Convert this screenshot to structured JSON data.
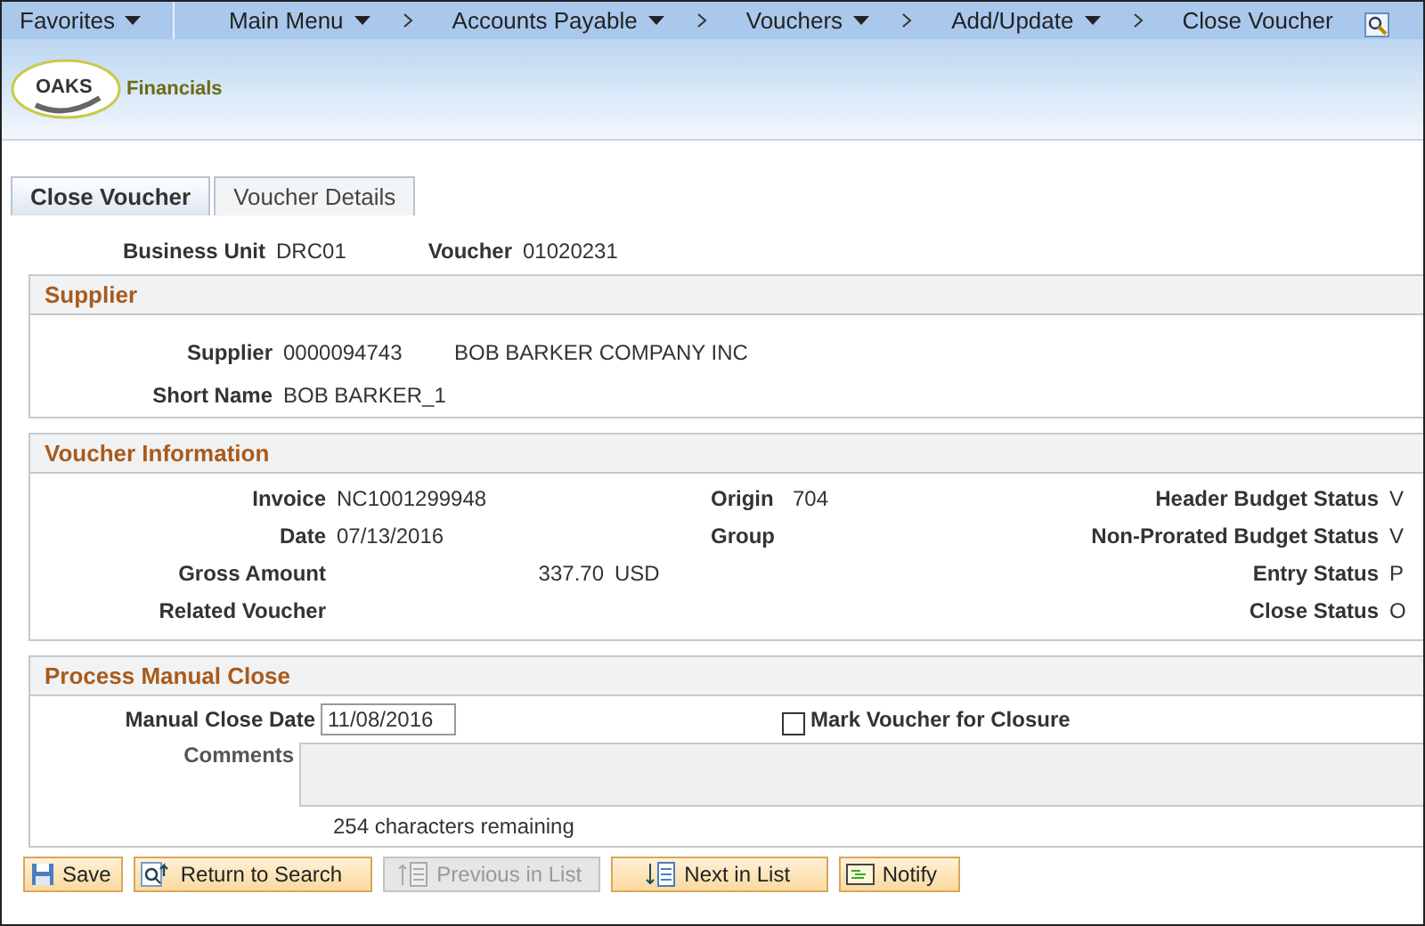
{
  "nav": [
    {
      "label": "Favorites",
      "dropdown": true
    },
    {
      "label": "Main Menu",
      "dropdown": true
    },
    {
      "label": "Accounts Payable",
      "dropdown": true
    },
    {
      "label": "Vouchers",
      "dropdown": true
    },
    {
      "label": "Add/Update",
      "dropdown": true
    },
    {
      "label": "Close Voucher",
      "dropdown": false
    }
  ],
  "logo": {
    "mark": "OAKS",
    "name": "Financials"
  },
  "tabs": [
    {
      "label": "Close Voucher",
      "selected": true
    },
    {
      "label": "Voucher Details",
      "selected": false
    }
  ],
  "header_fields": [
    {
      "label": "Business Unit",
      "value": "DRC01"
    },
    {
      "label": "Voucher",
      "value": "01020231"
    }
  ],
  "supplier": {
    "title": "Supplier",
    "supplier_label": "Supplier",
    "supplier_id": "0000094743",
    "supplier_name": "BOB BARKER COMPANY INC",
    "short_name_label": "Short Name",
    "short_name": "BOB BARKER_1"
  },
  "voucher_information": {
    "title": "Voucher Information",
    "rows": [
      {
        "label_1": "Invoice",
        "value_1": "NC1001299948",
        "label_2": "Origin",
        "value_2": "704",
        "label_3": "Header Budget Status",
        "value_3": "V"
      },
      {
        "label_1": "Date",
        "value_1": "07/13/2016",
        "label_2": "Group",
        "label_3": "Non-Prorated Budget Status",
        "value_3": "V"
      },
      {
        "label_1": "Gross Amount",
        "amount": "337.70",
        "currency": "USD",
        "label_3": "Entry Status",
        "value_3": "P"
      },
      {
        "label_1": "Related Voucher",
        "label_3": "Close Status",
        "value_3": "O"
      }
    ]
  },
  "process_manual_close": {
    "title": "Process Manual Close",
    "date_label": "Manual Close Date",
    "date_value": "11/08/2016",
    "checkbox_label": "Mark Voucher for Closure",
    "checked": false,
    "comments_label": "Comments",
    "remaining": "254 characters remaining"
  },
  "buttons": [
    {
      "label": "Save",
      "kind": "save",
      "disabled": false
    },
    {
      "label": "Return to Search",
      "kind": "search",
      "disabled": false
    },
    {
      "label": "Previous in List",
      "kind": "previous",
      "disabled": true
    },
    {
      "label": "Next in List",
      "kind": "next",
      "disabled": false
    },
    {
      "label": "Notify",
      "kind": "notify",
      "disabled": false
    }
  ]
}
